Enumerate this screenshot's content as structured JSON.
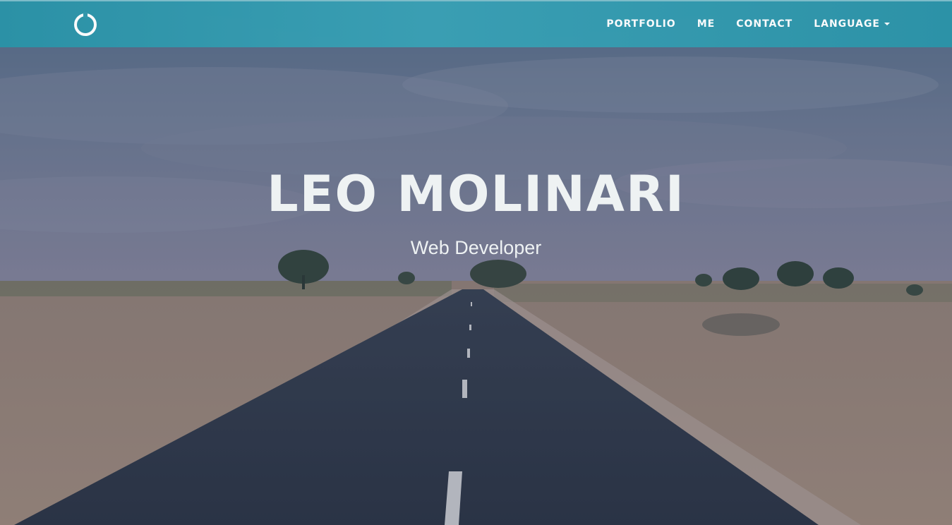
{
  "navbar": {
    "brand_icon": "ring-logo-icon",
    "items": [
      {
        "label": "PORTFOLIO"
      },
      {
        "label": "ME"
      },
      {
        "label": "CONTACT"
      },
      {
        "label": "LANGUAGE",
        "icon": "caret-down-icon"
      }
    ],
    "color": "#3499ad"
  },
  "hero": {
    "name": "LEO MOLINARI",
    "title": "Web Developer",
    "background": "desert-road-photo"
  }
}
